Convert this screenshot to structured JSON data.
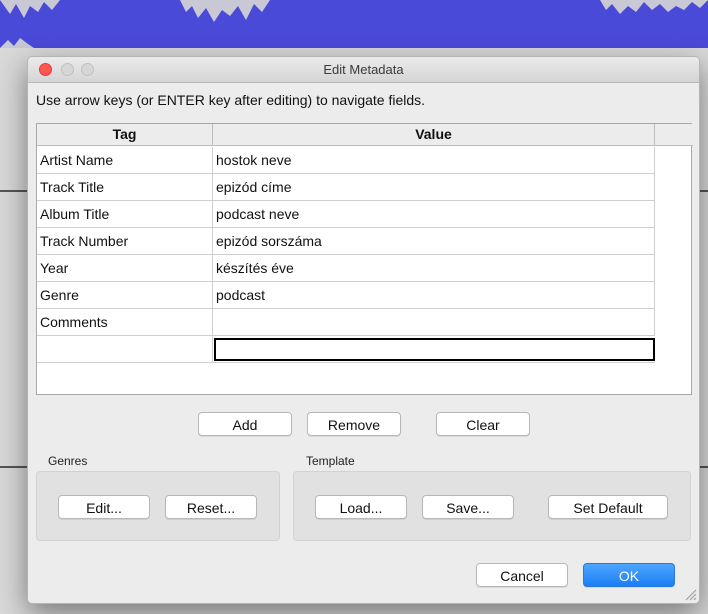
{
  "dialog": {
    "title": "Edit Metadata",
    "instructions": "Use arrow keys (or ENTER key after editing) to navigate fields."
  },
  "table": {
    "headers": {
      "tag": "Tag",
      "value": "Value"
    },
    "rows": [
      {
        "tag": "Artist Name",
        "value": "hostok neve"
      },
      {
        "tag": "Track Title",
        "value": "epizód címe"
      },
      {
        "tag": "Album Title",
        "value": "podcast neve"
      },
      {
        "tag": "Track Number",
        "value": "epizód sorszáma"
      },
      {
        "tag": "Year",
        "value": "készítés éve"
      },
      {
        "tag": "Genre",
        "value": "podcast"
      },
      {
        "tag": "Comments",
        "value": ""
      },
      {
        "tag": "",
        "value": ""
      }
    ]
  },
  "actions": {
    "add": "Add",
    "remove": "Remove",
    "clear": "Clear"
  },
  "genres": {
    "label": "Genres",
    "edit": "Edit...",
    "reset": "Reset..."
  },
  "template": {
    "label": "Template",
    "load": "Load...",
    "save": "Save...",
    "set_default": "Set Default"
  },
  "footer": {
    "cancel": "Cancel",
    "ok": "OK"
  },
  "colors": {
    "accent": "#1a7ef5",
    "close": "#fc5753",
    "waveform": "#4a4ad8"
  }
}
